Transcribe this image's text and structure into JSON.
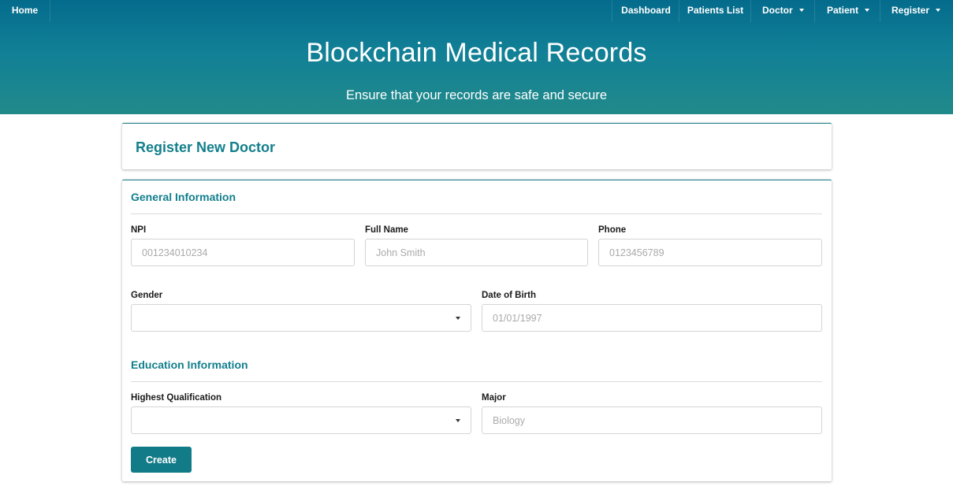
{
  "nav": {
    "home": "Home",
    "dashboard": "Dashboard",
    "patients_list": "Patients List",
    "doctor": "Doctor",
    "patient": "Patient",
    "register": "Register"
  },
  "hero": {
    "title": "Blockchain Medical Records",
    "subtitle": "Ensure that your records are safe and secure"
  },
  "page_title": "Register New Doctor",
  "general": {
    "title": "General Information",
    "npi": {
      "label": "NPI",
      "placeholder": "001234010234",
      "value": ""
    },
    "full_name": {
      "label": "Full Name",
      "placeholder": "John Smith",
      "value": ""
    },
    "phone": {
      "label": "Phone",
      "placeholder": "0123456789",
      "value": ""
    },
    "gender": {
      "label": "Gender",
      "value": ""
    },
    "dob": {
      "label": "Date of Birth",
      "placeholder": "01/01/1997",
      "value": ""
    }
  },
  "education": {
    "title": "Education Information",
    "qualification": {
      "label": "Highest Qualification",
      "value": ""
    },
    "major": {
      "label": "Major",
      "placeholder": "Biology",
      "value": ""
    }
  },
  "create_label": "Create",
  "colors": {
    "hero_top": "#046b8c",
    "hero_bottom": "#218a8a",
    "accent": "#127f8c",
    "button": "#127b88"
  }
}
